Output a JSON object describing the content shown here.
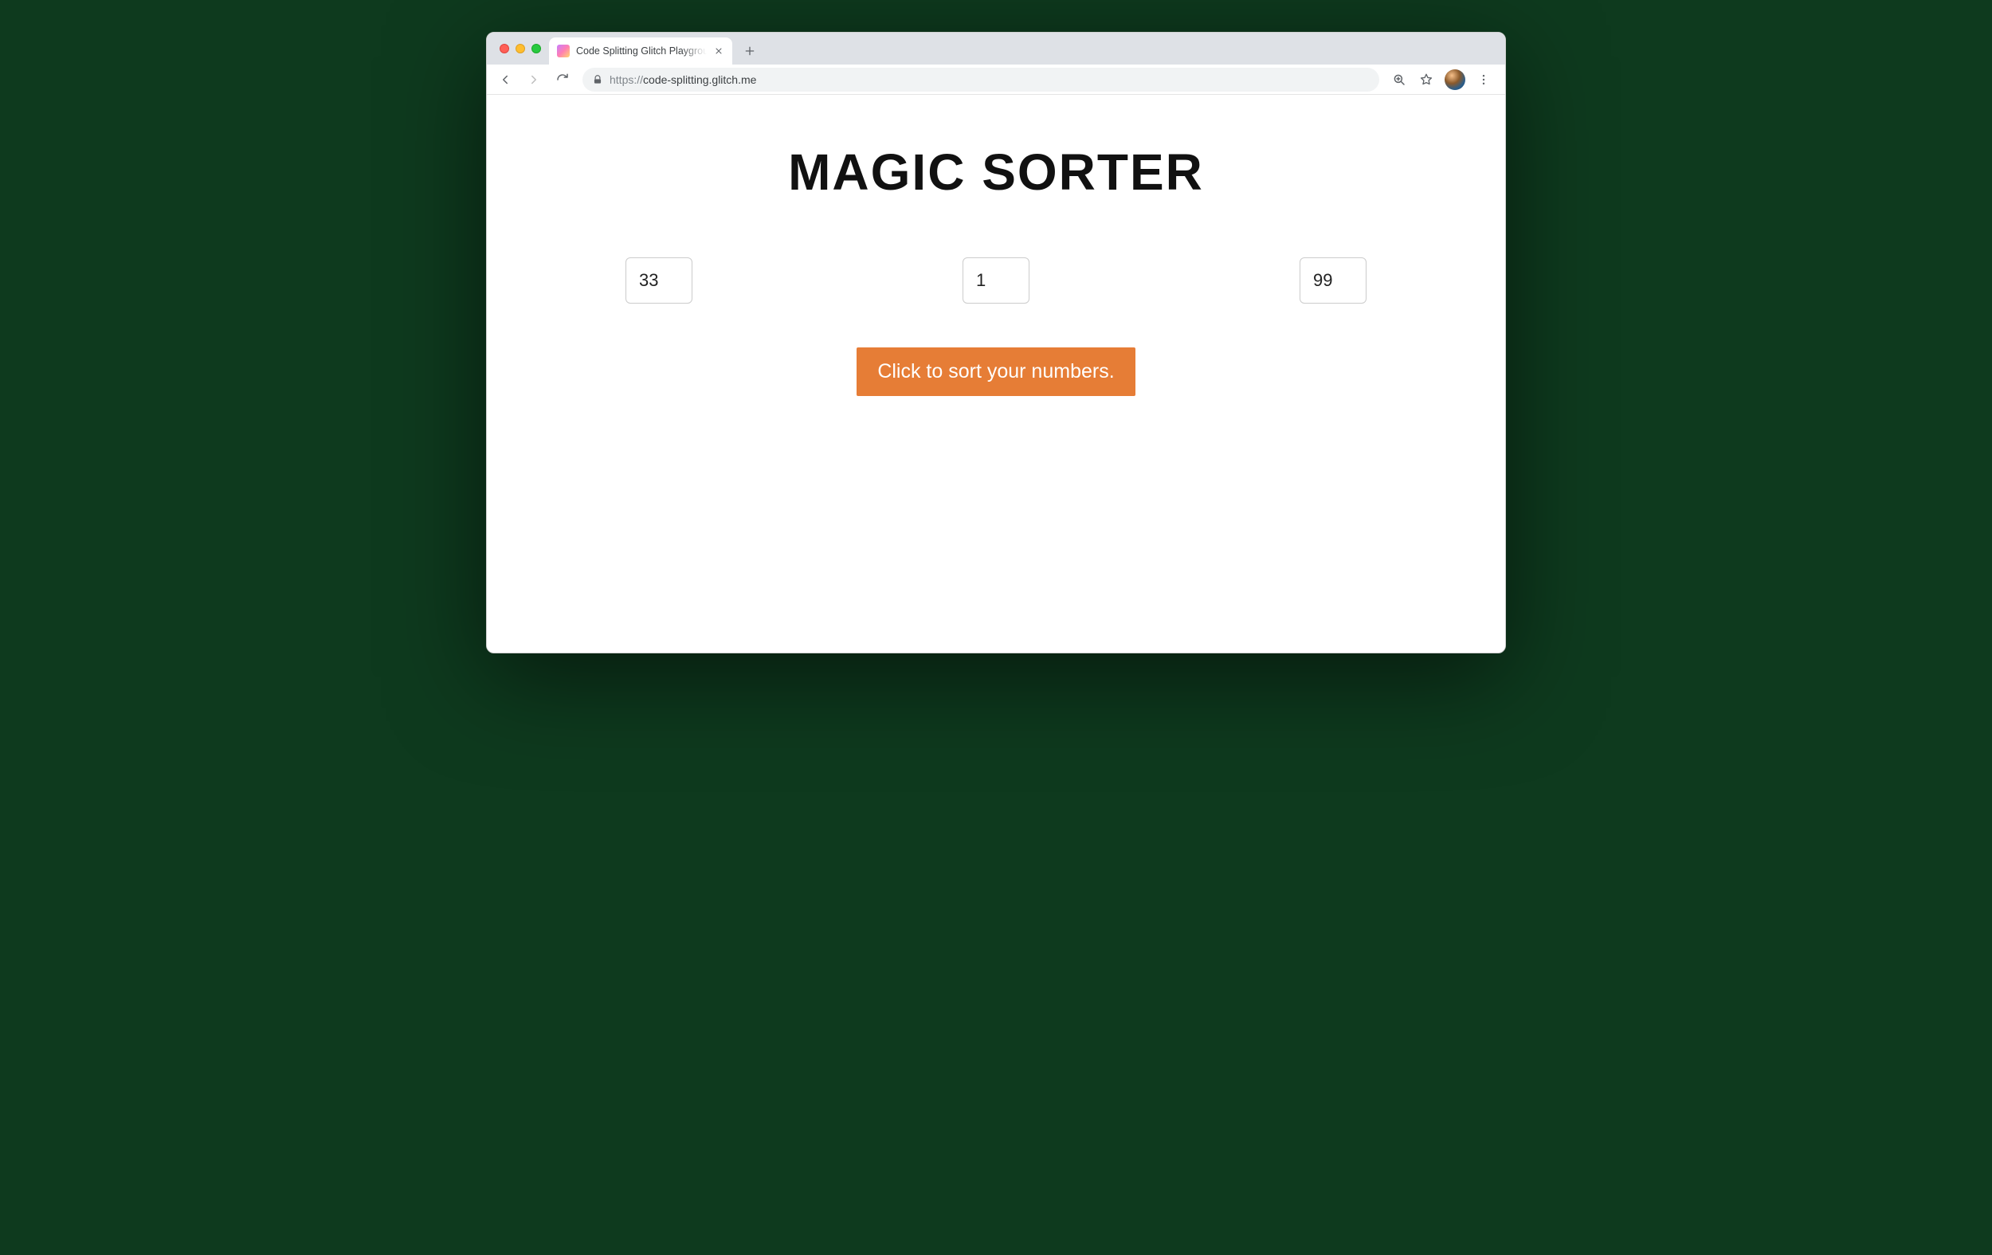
{
  "browser": {
    "tab": {
      "title": "Code Splitting Glitch Playground"
    },
    "url_scheme": "https://",
    "url_rest": "code-splitting.glitch.me"
  },
  "page": {
    "title": "MAGIC SORTER",
    "inputs": [
      "33",
      "1",
      "99"
    ],
    "button_label": "Click to sort your numbers."
  },
  "colors": {
    "accent": "#e67d36"
  }
}
